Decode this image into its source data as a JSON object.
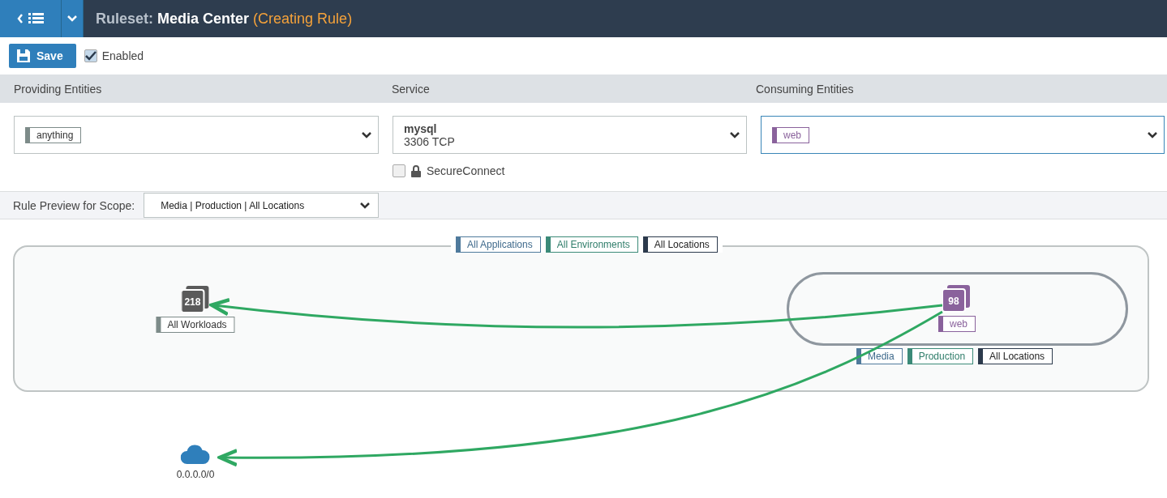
{
  "header": {
    "prefix": "Ruleset:",
    "title": "Media Center",
    "status": "(Creating Rule)"
  },
  "toolbar": {
    "save": "Save",
    "enabled": {
      "label": "Enabled",
      "checked": true
    }
  },
  "columns": [
    "Providing Entities",
    "Service",
    "Consuming Entities"
  ],
  "providing": {
    "labels": [
      {
        "text": "anything",
        "kind": "all"
      }
    ],
    "focused": false
  },
  "service": {
    "name": "mysql",
    "port": "3306 TCP",
    "focused": false
  },
  "secure_connect": {
    "label": "SecureConnect",
    "checked": false
  },
  "consuming": {
    "labels": [
      {
        "text": "web",
        "kind": "role"
      }
    ],
    "focused": true
  },
  "scope": {
    "label": "Rule Preview for Scope:",
    "value": "Media | Production | All Locations"
  },
  "diagram": {
    "scope_tags": [
      {
        "text": "All Applications",
        "kind": "app"
      },
      {
        "text": "All Environments",
        "kind": "env"
      },
      {
        "text": "All Locations",
        "kind": "loc"
      }
    ],
    "nodes": [
      {
        "count": "218",
        "label": "All Workloads",
        "kind": "all"
      },
      {
        "count": "98",
        "label": "web",
        "kind": "role"
      }
    ],
    "group_tags": [
      {
        "text": "Media",
        "kind": "app"
      },
      {
        "text": "Production",
        "kind": "env"
      },
      {
        "text": "All Locations",
        "kind": "loc"
      }
    ],
    "internet": {
      "label": "0.0.0.0/0"
    }
  }
}
